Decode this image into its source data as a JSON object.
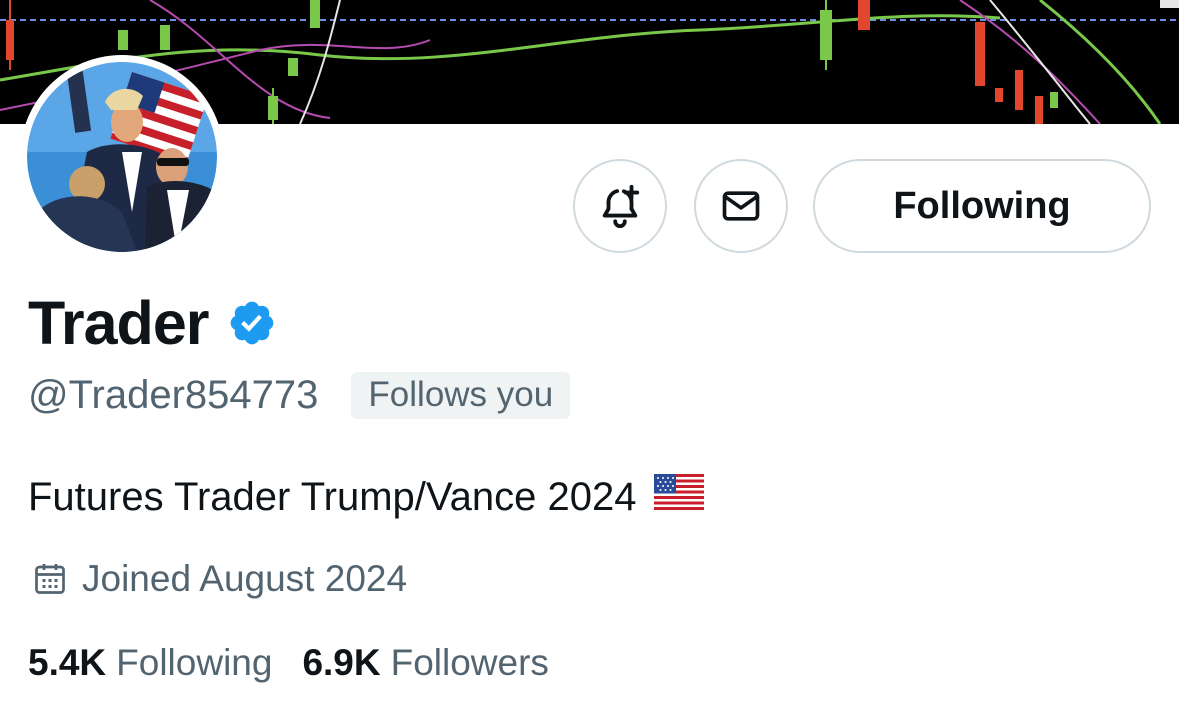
{
  "profile": {
    "display_name": "Trader",
    "handle": "@Trader854773",
    "follows_you_label": "Follows you",
    "bio": "Futures Trader Trump/Vance 2024",
    "bio_emoji": "us-flag-emoji",
    "joined": "Joined August 2024",
    "verified": true
  },
  "actions": {
    "notify_icon": "bell-plus-icon",
    "message_icon": "envelope-icon",
    "following_label": "Following"
  },
  "stats": {
    "following_count": "5.4K",
    "following_label": "Following",
    "followers_count": "6.9K",
    "followers_label": "Followers"
  },
  "colors": {
    "text_primary": "#0f1419",
    "text_secondary": "#536471",
    "border": "#cfd9de",
    "verified_blue": "#1d9bf0",
    "badge_bg": "#eff3f4"
  }
}
